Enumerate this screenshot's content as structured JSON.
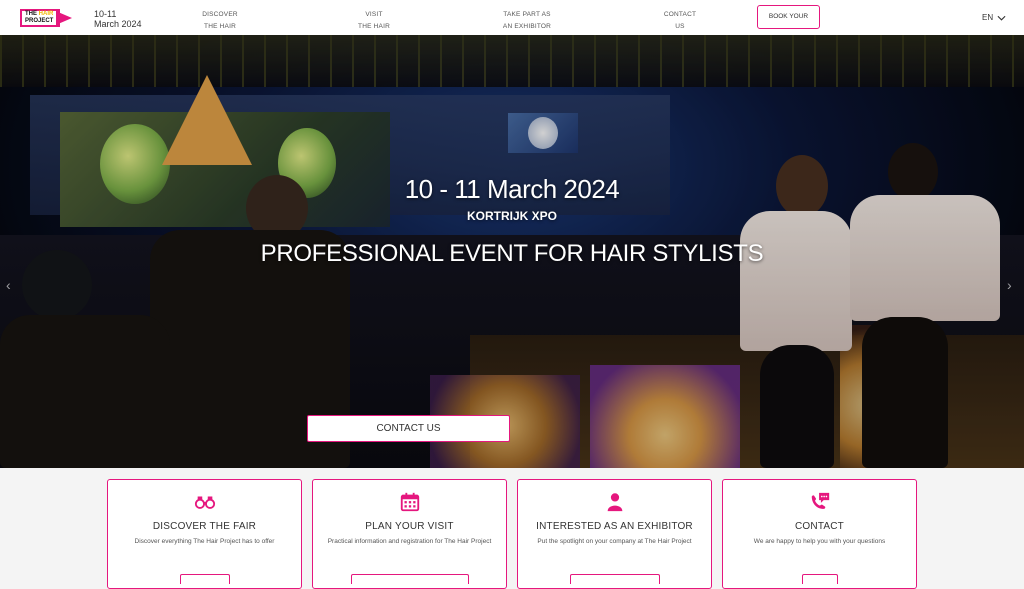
{
  "header": {
    "logo": {
      "line1_a": "THE ",
      "line1_b": "HAIR",
      "line2": "PROJECT"
    },
    "date": {
      "line1": "10-11",
      "line2": "March 2024"
    },
    "nav": [
      {
        "line1": "DISCOVER",
        "line2": "THE HAIR PROJECT"
      },
      {
        "line1": "VISIT",
        "line2": "THE HAIR PROJECT"
      },
      {
        "line1": "TAKE PART AS",
        "line2": "AN EXHIBITOR"
      },
      {
        "line1": "CONTACT",
        "line2": "US"
      }
    ],
    "book_label": "BOOK YOUR BOOTH",
    "language": "EN"
  },
  "hero": {
    "date": "10 - 11 March 2024",
    "venue": "KORTRIJK XPO",
    "subtitle": "PROFESSIONAL EVENT FOR HAIR STYLISTS",
    "cta": "CONTACT US",
    "prev_icon": "chevron-left-icon",
    "next_icon": "chevron-right-icon"
  },
  "cards": [
    {
      "icon": "binoculars-icon",
      "title": "DISCOVER THE FAIR",
      "desc": "Discover everything The Hair Project has to offer"
    },
    {
      "icon": "calendar-icon",
      "title": "PLAN YOUR VISIT",
      "desc": "Practical information and registration for The Hair Project"
    },
    {
      "icon": "person-icon",
      "title": "INTERESTED AS AN EXHIBITOR",
      "desc": "Put the spotlight on your company at The Hair Project"
    },
    {
      "icon": "chat-phone-icon",
      "title": "CONTACT",
      "desc": "We are happy to help you with your questions"
    }
  ],
  "colors": {
    "accent": "#e5177e",
    "logo_yellow": "#f2b705"
  }
}
